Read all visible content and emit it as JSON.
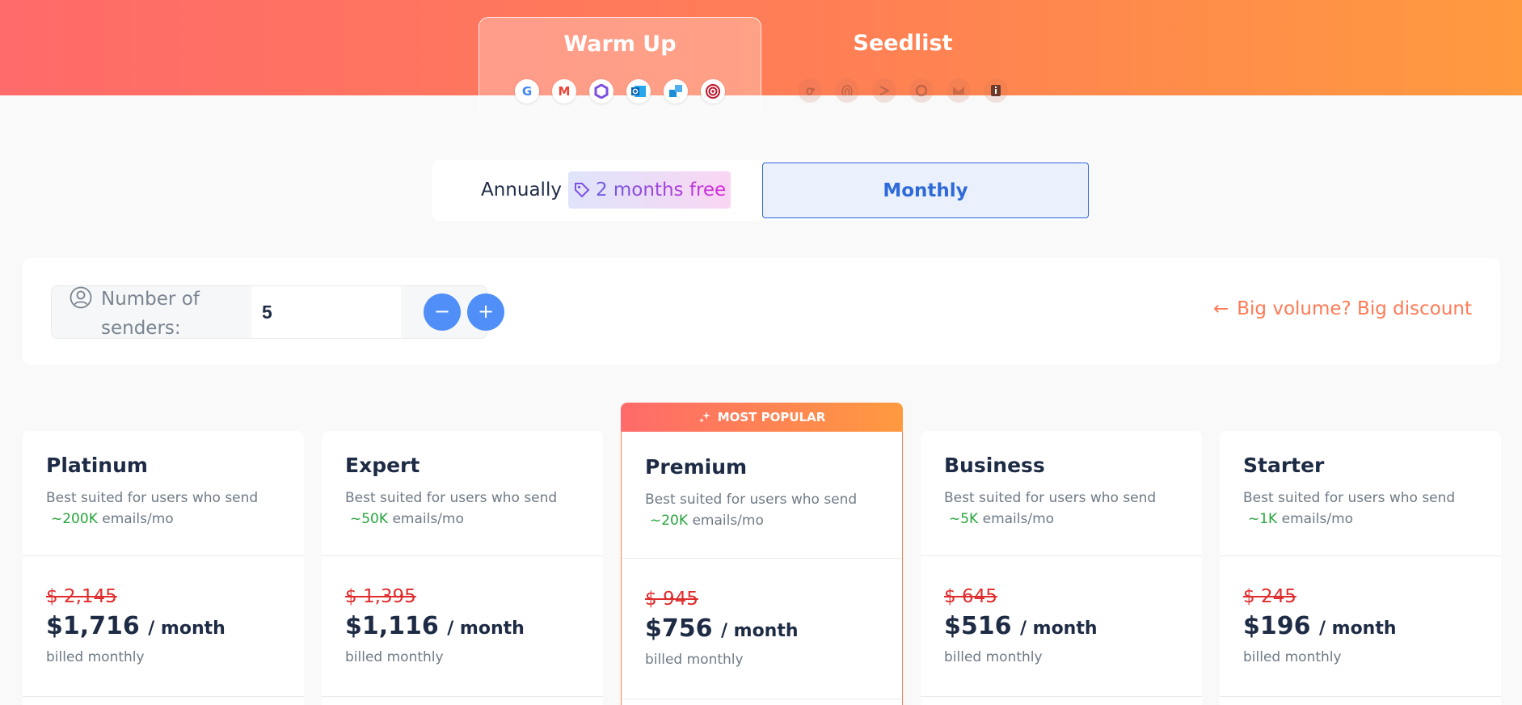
{
  "product_tabs": {
    "warmup": {
      "label": "Warm Up",
      "logos": [
        "google-icon",
        "gmail-icon",
        "microsoft365-icon",
        "outlook-icon",
        "exchange-icon",
        "target-icon"
      ]
    },
    "seedlist": {
      "label": "Seedlist",
      "logos": [
        "hubspot-icon",
        "fingerprint-icon",
        "sendgrid-icon",
        "loop-icon",
        "mailgun-icon",
        "info-icon"
      ]
    }
  },
  "billing": {
    "annual_label": "Annually",
    "annual_badge": "2 months free",
    "monthly_label": "Monthly",
    "selected": "Monthly"
  },
  "senders": {
    "label": "Number of senders:",
    "value": "5",
    "minus_label": "−",
    "plus_label": "+"
  },
  "discount_link": {
    "arrow": "←",
    "label": "Big volume? Big discount"
  },
  "popular_badge": "MOST POPULAR",
  "plans": [
    {
      "name": "Platinum",
      "desc": "Best suited for users who send",
      "volume": "~200K",
      "unit": "emails/mo",
      "old_price": "$ 2,145",
      "price": "$1,716",
      "per": "/ month",
      "billing": "billed monthly"
    },
    {
      "name": "Expert",
      "desc": "Best suited for users who send",
      "volume": "~50K",
      "unit": "emails/mo",
      "old_price": "$ 1,395",
      "price": "$1,116",
      "per": "/ month",
      "billing": "billed monthly"
    },
    {
      "name": "Premium",
      "desc": "Best suited for users who send",
      "volume": "~20K",
      "unit": "emails/mo",
      "old_price": "$ 945",
      "price": "$756",
      "per": "/ month",
      "billing": "billed monthly"
    },
    {
      "name": "Business",
      "desc": "Best suited for users who send",
      "volume": "~5K",
      "unit": "emails/mo",
      "old_price": "$ 645",
      "price": "$516",
      "per": "/ month",
      "billing": "billed monthly"
    },
    {
      "name": "Starter",
      "desc": "Best suited for users who send",
      "volume": "~1K",
      "unit": "emails/mo",
      "old_price": "$ 245",
      "price": "$196",
      "per": "/ month",
      "billing": "billed monthly"
    }
  ],
  "colors": {
    "accent_orange": "#ff7f55",
    "monthly_blue": "#2f6ad8",
    "stepper_blue": "#4f8ff7",
    "strike_red": "#e02c2c",
    "volume_green": "#27a53c"
  }
}
